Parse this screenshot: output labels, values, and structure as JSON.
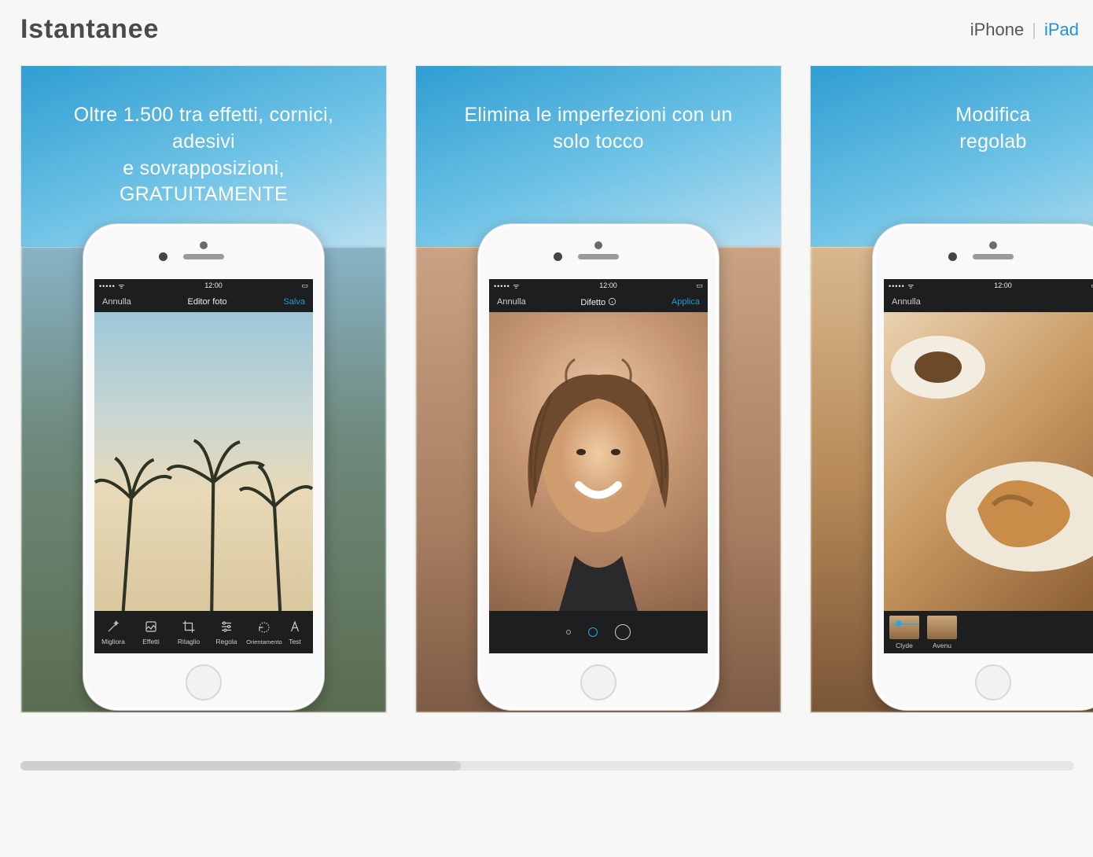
{
  "header": {
    "title": "Istantanee",
    "tab_iphone": "iPhone",
    "tab_ipad": "iPad"
  },
  "status": {
    "time": "12:00"
  },
  "screenshots": [
    {
      "promo_line1": "Oltre 1.500 tra effetti, cornici, adesivi",
      "promo_line2": "e sovrapposizioni, GRATUITAMENTE",
      "nav_left": "Annulla",
      "nav_center": "Editor foto",
      "nav_right": "Salva",
      "tools": [
        {
          "label": "Migliora"
        },
        {
          "label": "Effetti"
        },
        {
          "label": "Ritaglio"
        },
        {
          "label": "Regola"
        },
        {
          "label": "Orientamento"
        },
        {
          "label": "Test"
        }
      ]
    },
    {
      "promo_line1": "Elimina le imperfezioni con un",
      "promo_line2": "solo tocco",
      "nav_left": "Annulla",
      "nav_center": "Difetto",
      "nav_right": "Applica"
    },
    {
      "promo_line1": "Modifica",
      "promo_line2": "regolab",
      "nav_left": "Annulla",
      "nav_center": "",
      "nav_right": "",
      "filters": [
        {
          "label": "Clyde"
        },
        {
          "label": "Avenu"
        }
      ]
    }
  ]
}
